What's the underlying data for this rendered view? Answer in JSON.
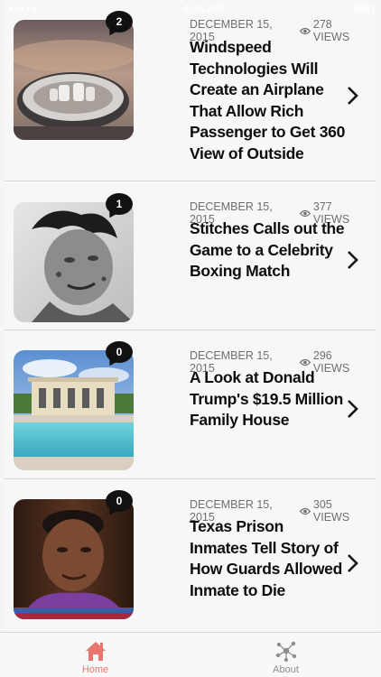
{
  "status_bar": {
    "time": "4:55 AM"
  },
  "articles": [
    {
      "date": "DECEMBER 15, 2015",
      "views": "278 VIEWS",
      "comments": "2",
      "title": "Windspeed Technologies Will Create an Airplane That Allow Rich Passenger to Get 360 View of Outside",
      "image": "airplane-fuselage-seats-photo"
    },
    {
      "date": "DECEMBER 15, 2015",
      "views": "377 VIEWS",
      "comments": "1",
      "title": "Stitches Calls out the Game to a Celebrity Boxing Match",
      "image": "tattooed-man-portrait-photo"
    },
    {
      "date": "DECEMBER 15, 2015",
      "views": "296 VIEWS",
      "comments": "0",
      "title": "A Look at Donald Trump's $19.5 Million Family House",
      "image": "mansion-with-pool-photo"
    },
    {
      "date": "DECEMBER 15, 2015",
      "views": "305 VIEWS",
      "comments": "0",
      "title": "Texas Prison Inmates Tell Story of How Guards Allowed Inmate to Die",
      "image": "man-interview-photo"
    }
  ],
  "tabbar": {
    "home_label": "Home",
    "about_label": "About",
    "home_icon": "house-icon",
    "about_icon": "network-icon",
    "active_color": "#e8756e",
    "inactive_color": "#8e8e8e"
  }
}
